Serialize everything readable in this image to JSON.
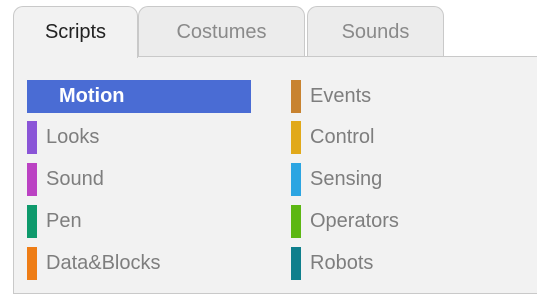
{
  "tabs": [
    {
      "label": "Scripts",
      "active": true
    },
    {
      "label": "Costumes",
      "active": false
    },
    {
      "label": "Sounds",
      "active": false
    }
  ],
  "categories": [
    {
      "label": "Motion",
      "color": "#4a6cd4",
      "selected": true
    },
    {
      "label": "Looks",
      "color": "#8a55d7",
      "selected": false
    },
    {
      "label": "Sound",
      "color": "#bb42c3",
      "selected": false
    },
    {
      "label": "Pen",
      "color": "#0e9a6c",
      "selected": false
    },
    {
      "label": "Data&Blocks",
      "color": "#ee7d16",
      "selected": false
    },
    {
      "label": "Events",
      "color": "#c88330",
      "selected": false
    },
    {
      "label": "Control",
      "color": "#e1a91a",
      "selected": false
    },
    {
      "label": "Sensing",
      "color": "#2ca5e2",
      "selected": false
    },
    {
      "label": "Operators",
      "color": "#5cb712",
      "selected": false
    },
    {
      "label": "Robots",
      "color": "#0f7f8c",
      "selected": false
    }
  ]
}
